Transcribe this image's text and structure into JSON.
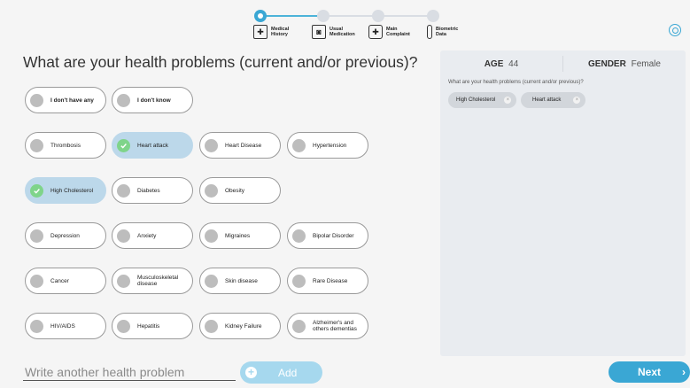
{
  "stepper": {
    "steps": [
      {
        "label": "Medical\nHistory"
      },
      {
        "label": "Usual\nMedication"
      },
      {
        "label": "Main\nComplaint"
      },
      {
        "label": "Biometric\nData"
      }
    ]
  },
  "question": "What are your health problems (current and/or previous)?",
  "options": [
    {
      "label": "I don't have any",
      "selected": false
    },
    {
      "label": "I don't know",
      "selected": false
    },
    {
      "label": "Thrombosis",
      "selected": false
    },
    {
      "label": "Heart attack",
      "selected": true
    },
    {
      "label": "Heart Disease",
      "selected": false
    },
    {
      "label": "Hypertension",
      "selected": false
    },
    {
      "label": "High Cholesterol",
      "selected": true
    },
    {
      "label": "Diabetes",
      "selected": false
    },
    {
      "label": "Obesity",
      "selected": false
    },
    {
      "label": "Depression",
      "selected": false
    },
    {
      "label": "Anxiety",
      "selected": false
    },
    {
      "label": "Migraines",
      "selected": false
    },
    {
      "label": "Bipolar Disorder",
      "selected": false
    },
    {
      "label": "Cancer",
      "selected": false
    },
    {
      "label": "Musculoskeletal disease",
      "selected": false
    },
    {
      "label": "Skin disease",
      "selected": false
    },
    {
      "label": "Rare Disease",
      "selected": false
    },
    {
      "label": "HIV/AIDS",
      "selected": false
    },
    {
      "label": "Hepatitis",
      "selected": false
    },
    {
      "label": "Kidney Failure",
      "selected": false
    },
    {
      "label": "Alzheimer's and others dementias",
      "selected": false
    }
  ],
  "other_input": {
    "placeholder": "Write another health problem",
    "value": ""
  },
  "add_label": "Add",
  "summary": {
    "age_label": "AGE",
    "age_value": "44",
    "gender_label": "GENDER",
    "gender_value": "Female",
    "question": "What are your health problems (current and/or previous)?",
    "tags": [
      "High Cholesterol",
      "Heart attack"
    ]
  },
  "next_label": "Next",
  "colors": {
    "accent": "#3aa7d4",
    "selected_chip": "#bcd8ea",
    "check": "#7fd48a"
  }
}
